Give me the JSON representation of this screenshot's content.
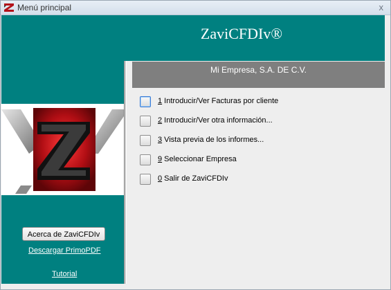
{
  "window": {
    "title": "Menú principal",
    "close_glyph": "x",
    "icon": "z-logo-icon"
  },
  "header": {
    "app_name": "ZaviCFDIv®",
    "background": "#008080"
  },
  "company": {
    "name": "Mi Empresa, S.A. DE C.V.",
    "background": "#7f7f7f"
  },
  "left_panel": {
    "logo": "zavi-z-logo",
    "about_button": "Acerca de ZaviCFDIv",
    "download_link": "Descargar PrimoPDF",
    "tutorial_link": "Tutorial"
  },
  "menu": [
    {
      "hotkey": "1",
      "label": " Introducir/Ver Facturas por cliente"
    },
    {
      "hotkey": "2",
      "label": " Introducir/Ver otra información..."
    },
    {
      "hotkey": "3",
      "label": " Vista previa de los informes..."
    },
    {
      "hotkey": "9",
      "label": " Seleccionar Empresa"
    },
    {
      "hotkey": "0",
      "label": " Salir de ZaviCFDIv"
    }
  ]
}
